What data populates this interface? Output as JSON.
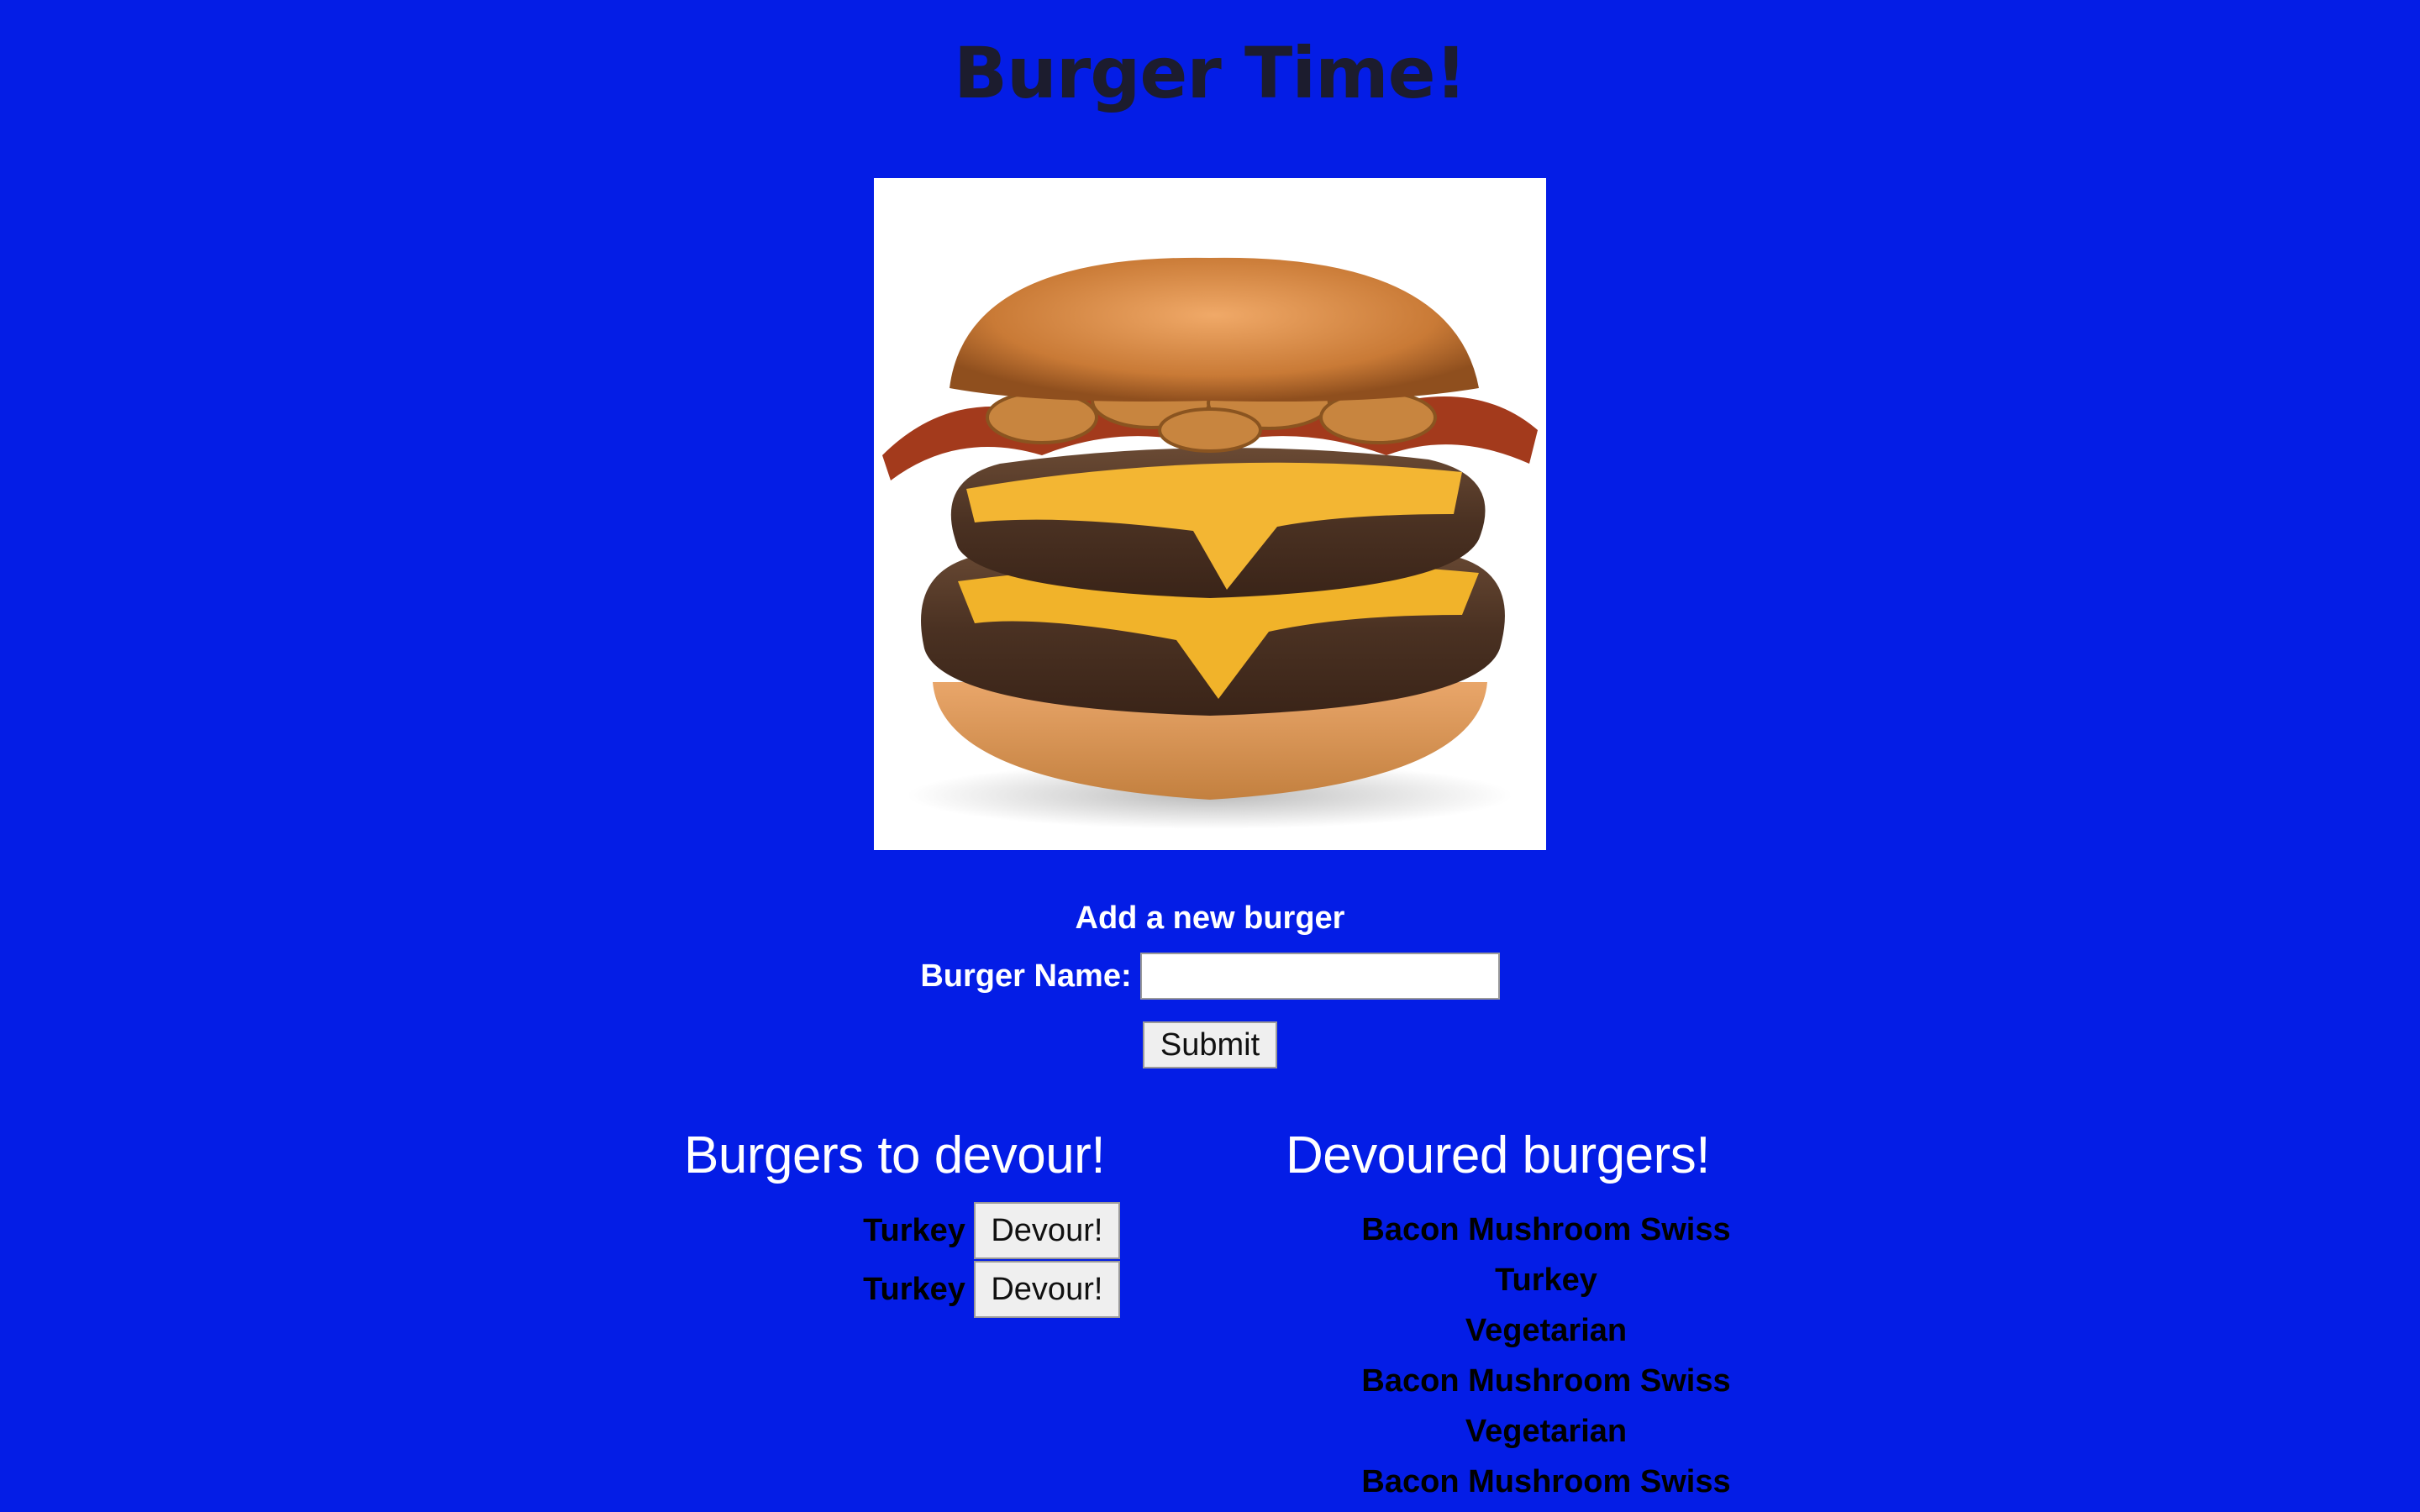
{
  "header": {
    "title": "Burger Time!"
  },
  "hero_image": {
    "icon": "burger-photo",
    "background": "#ffffff"
  },
  "form": {
    "title": "Add a new burger",
    "label": "Burger Name:",
    "input_value": "",
    "submit_label": "Submit"
  },
  "to_devour": {
    "title": "Burgers to devour!",
    "items": [
      {
        "name": "Turkey",
        "button": "Devour!"
      },
      {
        "name": "Turkey",
        "button": "Devour!"
      }
    ]
  },
  "devoured": {
    "title": "Devoured burgers!",
    "items": [
      "Bacon Mushroom Swiss",
      "Turkey",
      "Vegetarian",
      "Bacon Mushroom Swiss",
      "Vegetarian",
      "Bacon Mushroom Swiss"
    ]
  },
  "colors": {
    "page_background": "#041de6",
    "title": "#1c1c2e",
    "text": "#ffffff",
    "list_text": "#000000"
  }
}
